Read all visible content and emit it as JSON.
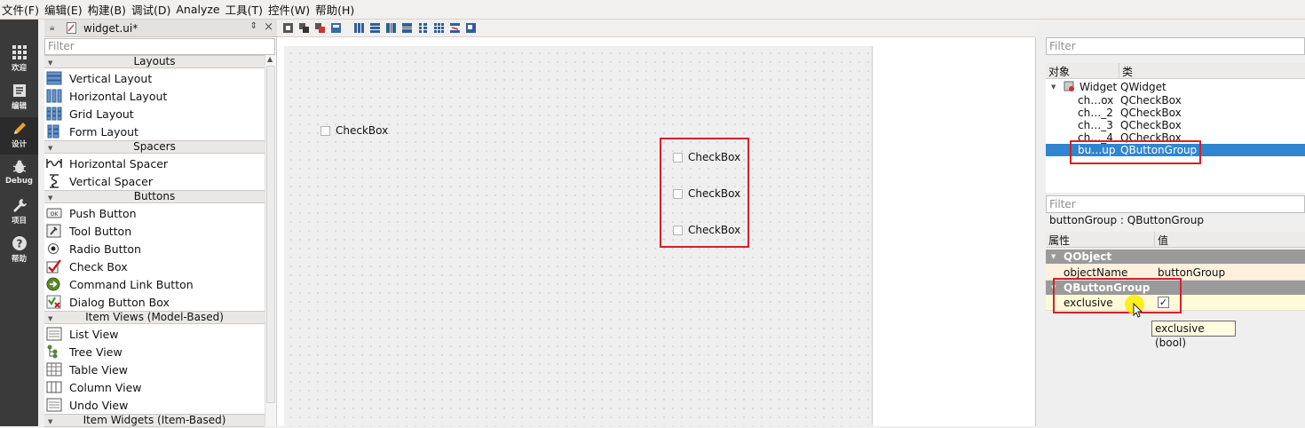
{
  "menubar": {
    "items": [
      "文件(F)",
      "编辑(E)",
      "构建(B)",
      "调试(D)",
      "Analyze",
      "工具(T)",
      "控件(W)",
      "帮助(H)"
    ]
  },
  "modes": [
    {
      "label": "欢迎",
      "icon": "grid-icon"
    },
    {
      "label": "编辑",
      "icon": "edit-doc-icon"
    },
    {
      "label": "设计",
      "icon": "pencil-icon"
    },
    {
      "label": "Debug",
      "icon": "bug-icon"
    },
    {
      "label": "项目",
      "icon": "wrench-icon"
    },
    {
      "label": "帮助",
      "icon": "help-icon"
    }
  ],
  "editor": {
    "file_name": "widget.ui*",
    "filter_placeholder": "Filter"
  },
  "widget_box": {
    "categories": {
      "layouts": "Layouts",
      "spacers": "Spacers",
      "buttons": "Buttons",
      "item_views": "Item Views (Model-Based)",
      "item_widgets": "Item Widgets (Item-Based)"
    },
    "layouts": [
      "Vertical Layout",
      "Horizontal Layout",
      "Grid Layout",
      "Form Layout"
    ],
    "spacers": [
      "Horizontal Spacer",
      "Vertical Spacer"
    ],
    "buttons": [
      "Push Button",
      "Tool Button",
      "Radio Button",
      "Check Box",
      "Command Link Button",
      "Dialog Button Box"
    ],
    "item_views": [
      "List View",
      "Tree View",
      "Table View",
      "Column View",
      "Undo View"
    ]
  },
  "form": {
    "checkboxes": [
      "CheckBox",
      "CheckBox",
      "CheckBox",
      "CheckBox"
    ]
  },
  "object_inspector": {
    "filter_placeholder": "Filter",
    "col_object": "对象",
    "col_class": "类",
    "rows": [
      {
        "name": "Widget",
        "cls": "QWidget"
      },
      {
        "name": "ch…ox",
        "cls": "QCheckBox"
      },
      {
        "name": "ch…_2",
        "cls": "QCheckBox"
      },
      {
        "name": "ch…_3",
        "cls": "QCheckBox"
      },
      {
        "name": "ch…_4",
        "cls": "QCheckBox"
      },
      {
        "name": "bu…up",
        "cls": "QButtonGroup"
      }
    ]
  },
  "property_editor": {
    "filter_placeholder": "Filter",
    "current": "buttonGroup : QButtonGroup",
    "col_property": "属性",
    "col_value": "值",
    "group_qobject": "QObject",
    "object_name_label": "objectName",
    "object_name_value": "buttonGroup",
    "group_qbuttongroup": "QButtonGroup",
    "exclusive_label": "exclusive",
    "exclusive_checked": "✓",
    "tooltip": "exclusive (bool)"
  },
  "colors": {
    "highlight": "#d7202a",
    "selection": "#2f85cf",
    "modebar": "#3a3a3a"
  }
}
